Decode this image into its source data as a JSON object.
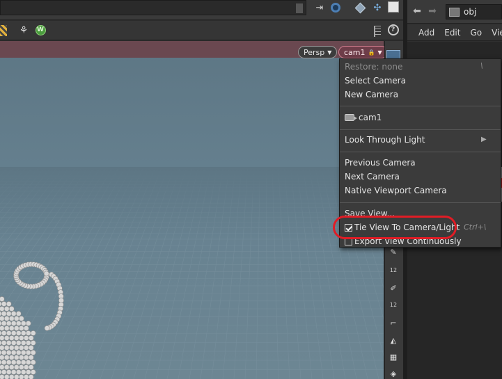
{
  "viewport": {
    "persp_label": "Persp",
    "camera_label": "cam1"
  },
  "camera_menu": {
    "restore": "Restore: none",
    "restore_shortcut": "\\",
    "select_camera": "Select Camera",
    "new_camera": "New Camera",
    "camera_item": "cam1",
    "look_through_light": "Look Through Light",
    "previous_camera": "Previous Camera",
    "next_camera": "Next Camera",
    "native_viewport_camera": "Native Viewport Camera",
    "save_view": "Save View...",
    "tie_view": "Tie View To Camera/Light",
    "tie_view_shortcut": "Ctrl+\\",
    "tie_view_checked": true,
    "export_view": "Export View Continuously",
    "export_view_checked": false
  },
  "vp_toolbar": {
    "snap_value_1": "12",
    "snap_value_2": "12"
  },
  "network": {
    "path": "obj",
    "menu": [
      "Add",
      "Edit",
      "Go",
      "View"
    ]
  },
  "colors": {
    "highlight": "#e11c25",
    "camera_pill": "#6e3d49",
    "viewport_bg": "#668190"
  },
  "icons": {
    "toolbar": [
      "pin-icon",
      "target-icon",
      "cube-icon",
      "transform-icon",
      "background-icon",
      "snap-icon",
      "view-w-icon",
      "ruler-icon",
      "help-icon"
    ],
    "network": [
      "back-arrow-icon",
      "forward-arrow-icon",
      "obj-network-icon"
    ]
  }
}
